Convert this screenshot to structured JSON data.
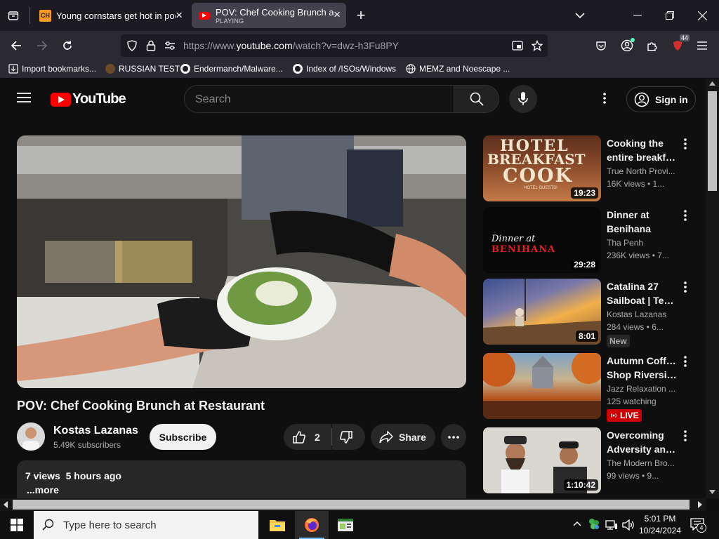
{
  "browser": {
    "tabs": [
      {
        "favicon": "CH",
        "title": "Young cornstars get hot in pool",
        "close_label": "×"
      },
      {
        "title": "POV: Chef Cooking Brunch at R",
        "status": "PLAYING",
        "close_label": "×"
      }
    ],
    "new_tab_label": "+",
    "url_prefix": "https://www.",
    "url_domain": "youtube.com",
    "url_path": "/watch?v=dwz-h3Fu8PY",
    "extension_badge": "44",
    "bookmarks": [
      {
        "label": "Import bookmarks..."
      },
      {
        "label": "RUSSIAN TEST"
      },
      {
        "label": "Endermanch/Malware..."
      },
      {
        "label": "Index of /ISOs/Windows"
      },
      {
        "label": "MEMZ and Noescape ..."
      }
    ]
  },
  "youtube": {
    "logo_text": "YouTube",
    "search_placeholder": "Search",
    "sign_in_label": "Sign in",
    "video": {
      "title": "POV: Chef Cooking Brunch at Restaurant",
      "channel": "Kostas Lazanas",
      "subscribers": "5.49K subscribers",
      "subscribe_label": "Subscribe",
      "likes": "2",
      "share_label": "Share",
      "views": "7 views",
      "posted": "5 hours ago",
      "more_label": "...more"
    },
    "recommendations": [
      {
        "title_line1": "Cooking the",
        "title_line2": "entire breakfa...",
        "channel": "True North Provi...",
        "meta": "16K views  • 1...",
        "duration": "19:23",
        "thumb_text1": "HOTEL",
        "thumb_text2": "BREAKFAST",
        "thumb_text3": "COOK",
        "thumb_text4": "HOTEL GUESTS!"
      },
      {
        "title_line1": "Dinner at",
        "title_line2": "Benihana",
        "channel": "Tha Penh",
        "meta": "236K views  • 7...",
        "duration": "29:28",
        "thumb_text1": "Dinner at",
        "thumb_text2": "BENIHANA"
      },
      {
        "title_line1": "Catalina 27",
        "title_line2": "Sailboat | Tex...",
        "channel": "Kostas Lazanas",
        "meta": "284 views  • 6...",
        "duration": "8:01",
        "badge": "New"
      },
      {
        "title_line1": "Autumn Coffee",
        "title_line2": "Shop Riversid...",
        "channel": "Jazz Relaxation ...",
        "meta": "125 watching",
        "badge": "LIVE"
      },
      {
        "title_line1": "Overcoming",
        "title_line2": "Adversity and...",
        "channel": "The Modern Bro...",
        "meta": "99 views  • 9...",
        "duration": "1:10:42"
      }
    ]
  },
  "taskbar": {
    "search_placeholder": "Type here to search",
    "time": "5:01 PM",
    "date": "10/24/2024",
    "notification_count": "4"
  },
  "colors": {
    "youtube_red": "#ff0000",
    "background": "#0f0f0f",
    "live_badge": "#cc0000",
    "tab_active": "#42414d"
  }
}
